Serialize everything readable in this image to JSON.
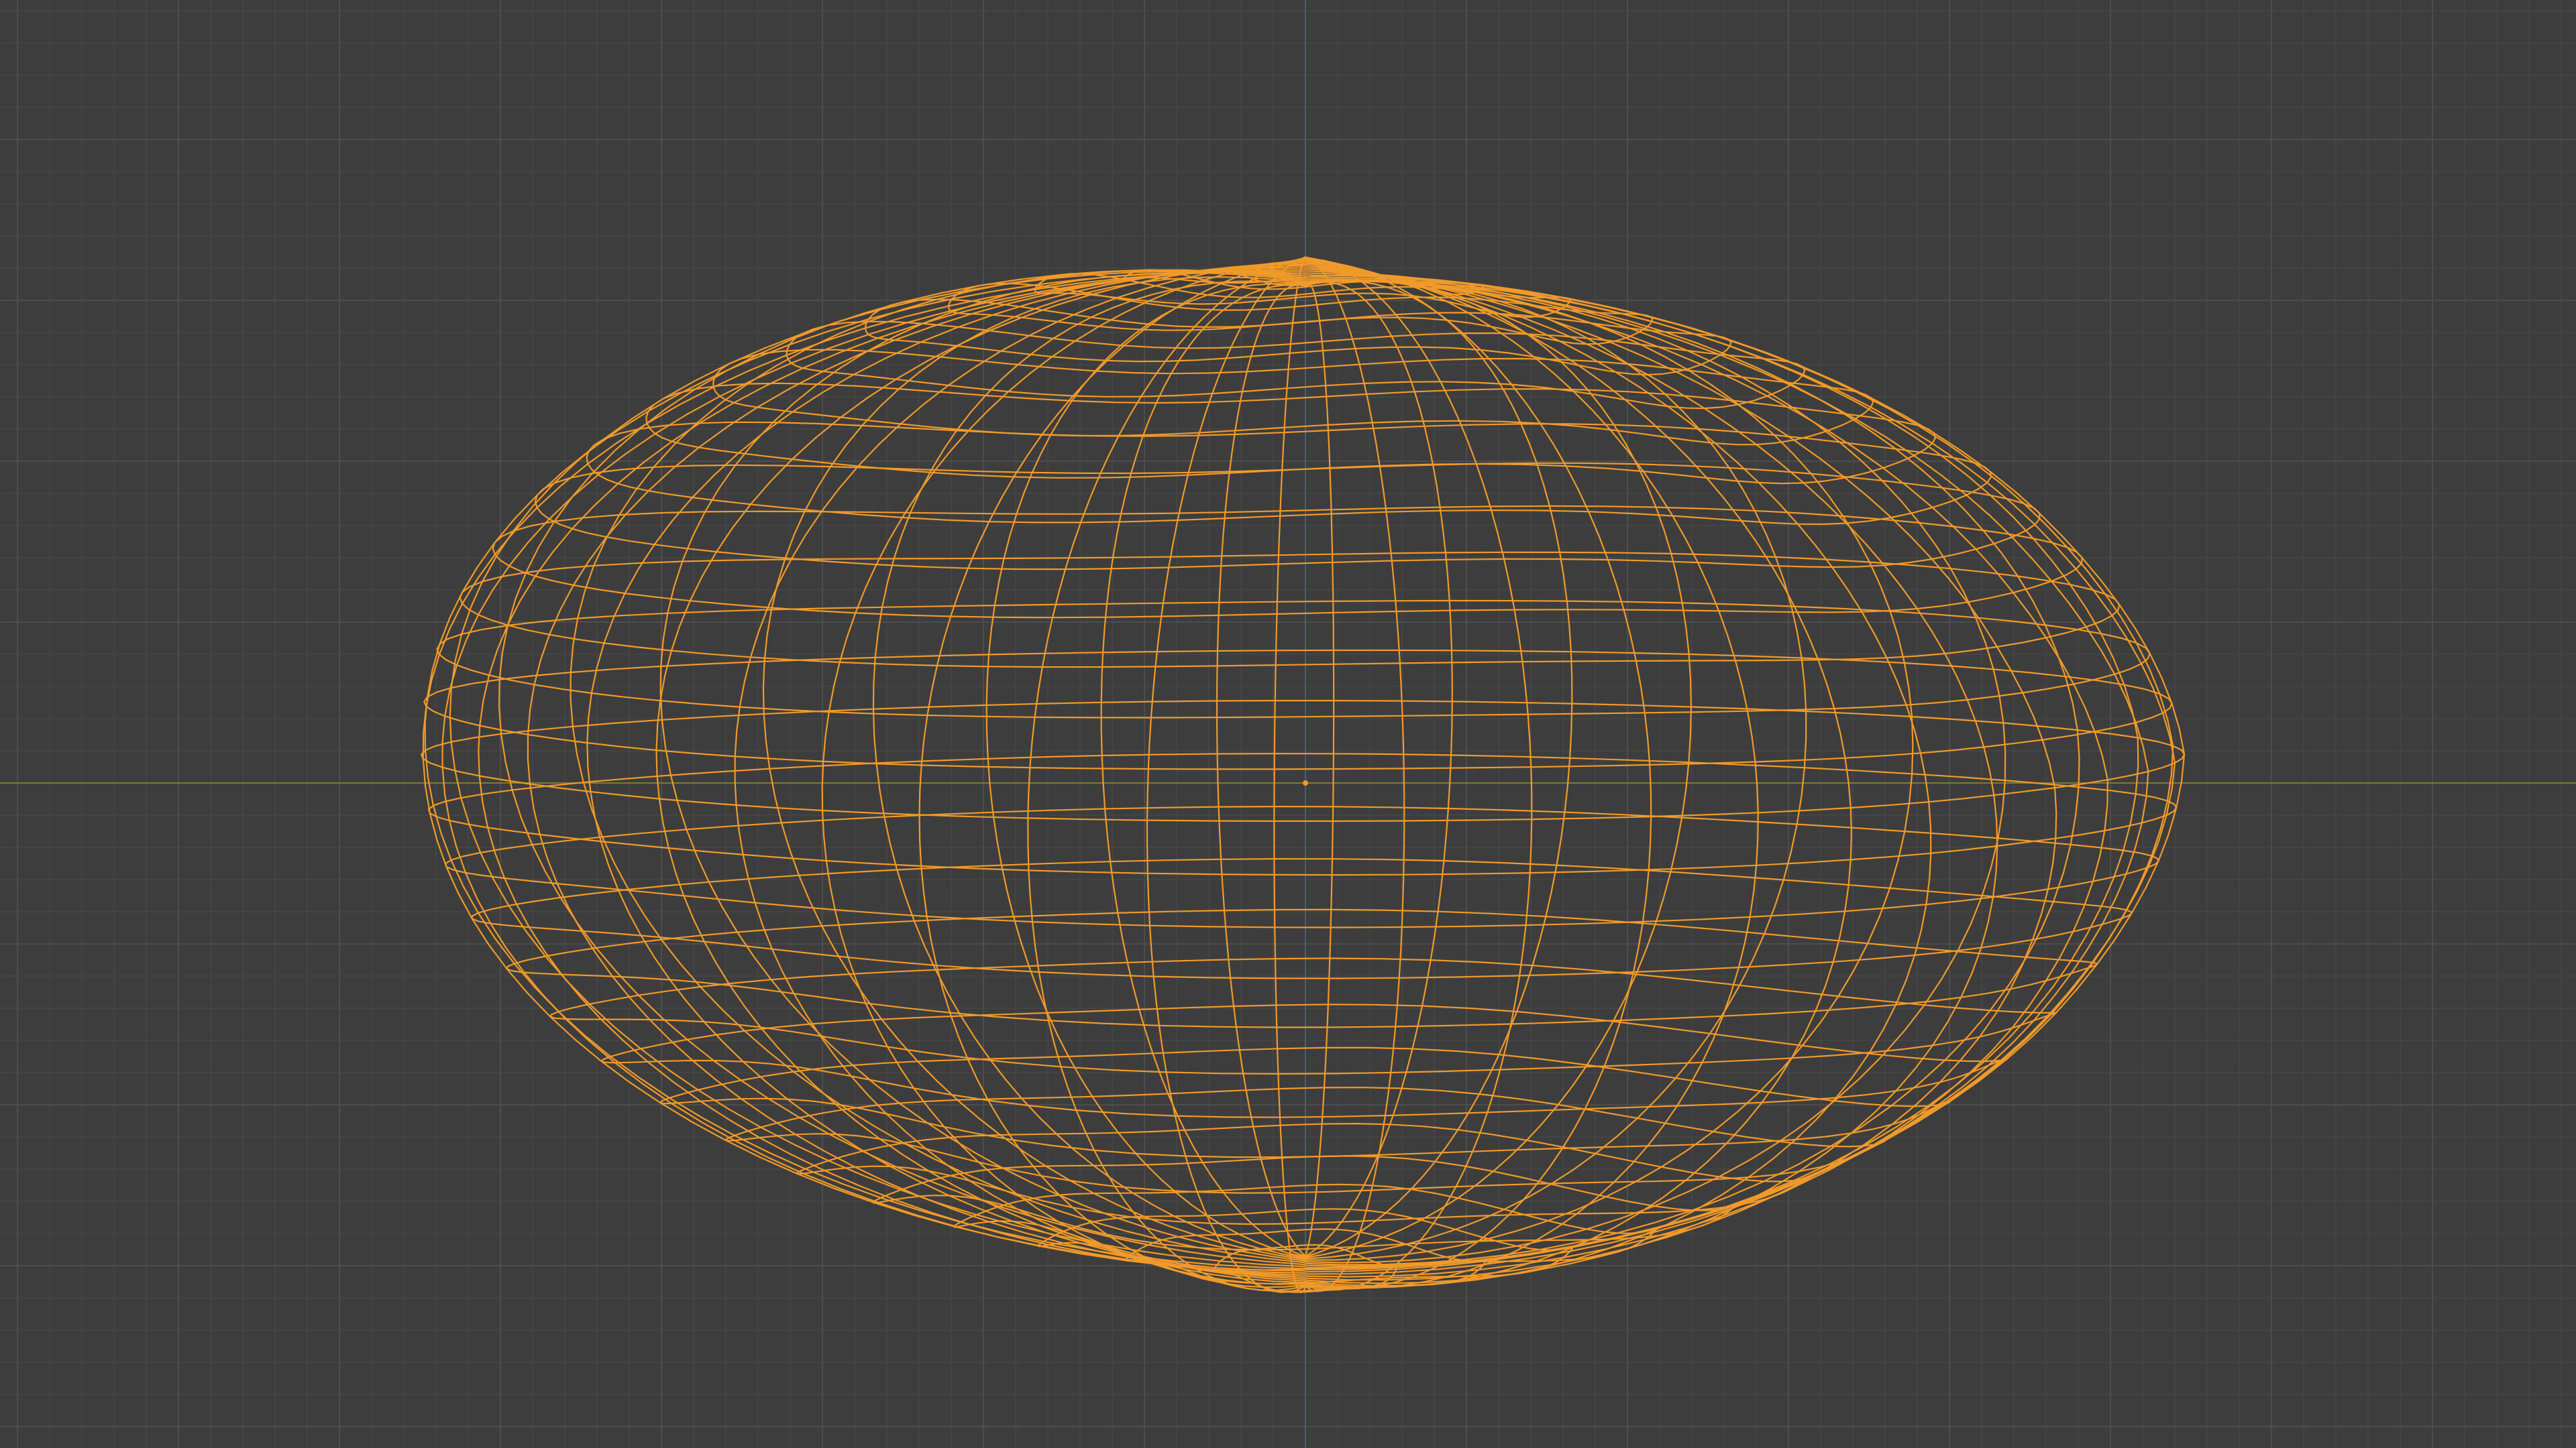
{
  "viewport": {
    "background_color": "#3d3d3d",
    "grid_minor_color": "#464646",
    "grid_major_color": "#4d4d4d",
    "x_axis_color": "#7a7a37",
    "z_axis_color": "#3f5f8f",
    "mesh_color": "#f09a2a",
    "origin_color": "#f09a2a",
    "shading_mode": "wireframe",
    "selected_object": "mesh",
    "icons": [
      "object-origin-icon"
    ]
  }
}
